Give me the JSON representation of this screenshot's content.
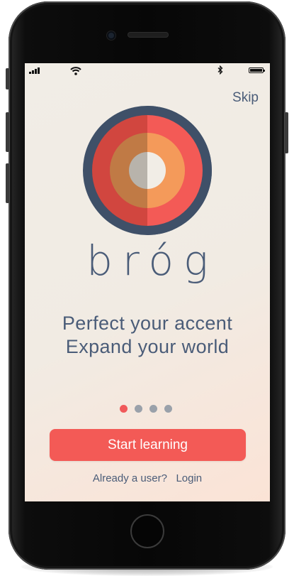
{
  "status_bar": {
    "signal_icon": "signal-bars-icon",
    "wifi_icon": "wifi-icon",
    "bluetooth_icon": "bluetooth-icon",
    "battery_icon": "battery-icon",
    "battery_level": 0.95
  },
  "header": {
    "skip_label": "Skip"
  },
  "brand": {
    "name": "bróg",
    "logo_icon": "concentric-circles-logo",
    "colors": {
      "outer_ring": "#3f5068",
      "red_left": "#d1463f",
      "red_right": "#f35a56",
      "orange_left": "#c07a45",
      "orange_right": "#f49a5a",
      "center_left": "#b8b3ab",
      "center_right": "#f1ede6"
    }
  },
  "hero": {
    "line1": "Perfect your accent",
    "line2": "Expand your world"
  },
  "pager": {
    "total": 4,
    "active_index": 0
  },
  "cta": {
    "start_label": "Start learning"
  },
  "login": {
    "prompt": "Already a user?",
    "link_label": "Login"
  },
  "colors": {
    "accent": "#f35a56",
    "text": "#4a5c78",
    "dot_inactive": "#9aa1aa"
  }
}
